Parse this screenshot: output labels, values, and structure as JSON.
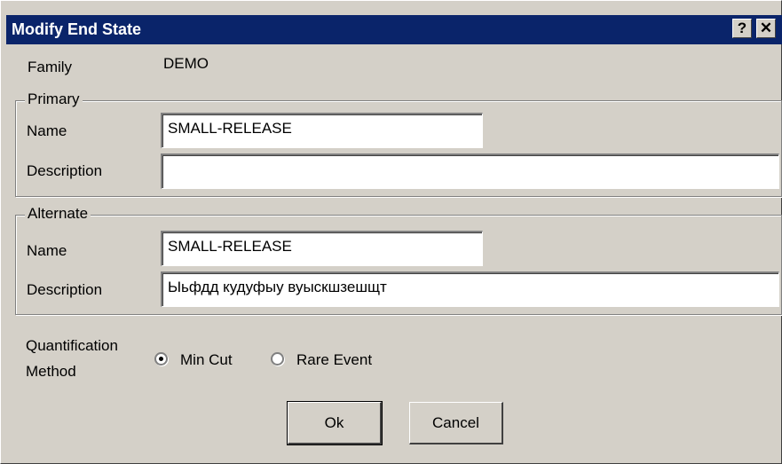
{
  "window": {
    "title": "Modify End State",
    "help_glyph": "?",
    "close_glyph": "✕"
  },
  "family": {
    "label": "Family",
    "value": "DEMO"
  },
  "primary": {
    "legend": "Primary",
    "name_label": "Name",
    "name_value": "SMALL-RELEASE",
    "description_label": "Description",
    "description_value": ""
  },
  "alternate": {
    "legend": "Alternate",
    "name_label": "Name",
    "name_value": "SMALL-RELEASE",
    "description_label": "Description",
    "description_value": "Ыьфдд кудуфыу вуыскшзешщт"
  },
  "quantification": {
    "label_line1": "Quantification",
    "label_line2": "Method",
    "options": [
      {
        "label": "Min Cut",
        "selected": true
      },
      {
        "label": "Rare Event",
        "selected": false
      }
    ]
  },
  "buttons": {
    "ok": "Ok",
    "cancel": "Cancel"
  }
}
